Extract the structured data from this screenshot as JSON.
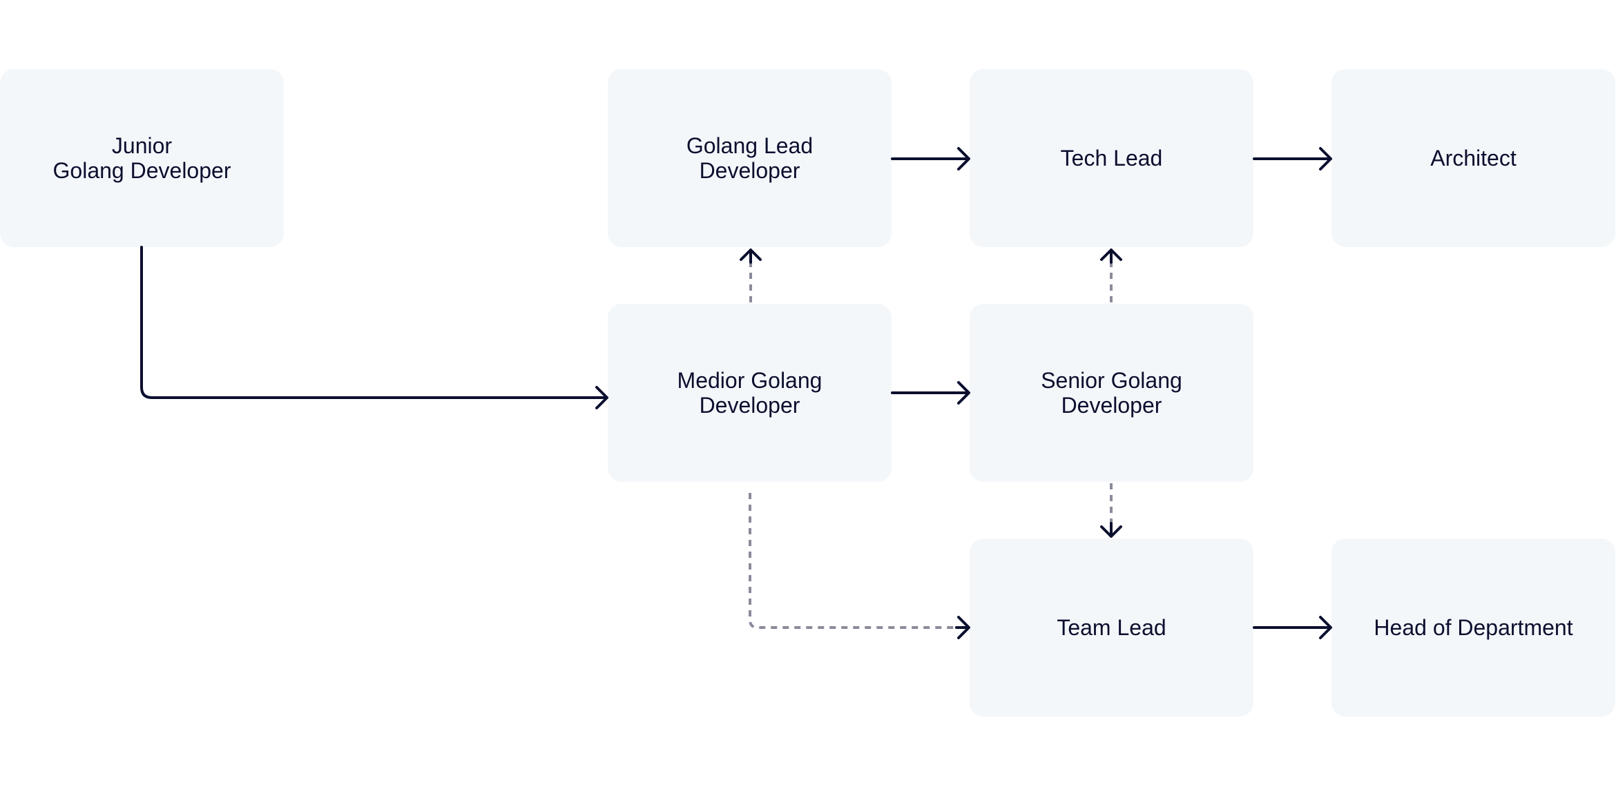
{
  "nodes": {
    "junior": "Junior\nGolang Developer",
    "golang_lead": "Golang Lead\nDeveloper",
    "tech_lead": "Tech Lead",
    "architect": "Architect",
    "medior": "Medior Golang\nDeveloper",
    "senior": "Senior Golang\nDeveloper",
    "team_lead": "Team Lead",
    "head_of_department": "Head of Department"
  },
  "edges": [
    {
      "from": "junior",
      "to": "medior",
      "style": "solid"
    },
    {
      "from": "medior",
      "to": "senior",
      "style": "solid"
    },
    {
      "from": "golang_lead",
      "to": "tech_lead",
      "style": "solid"
    },
    {
      "from": "tech_lead",
      "to": "architect",
      "style": "solid"
    },
    {
      "from": "team_lead",
      "to": "head_of_department",
      "style": "solid"
    },
    {
      "from": "medior",
      "to": "golang_lead",
      "style": "dashed"
    },
    {
      "from": "senior",
      "to": "tech_lead",
      "style": "dashed"
    },
    {
      "from": "senior",
      "to": "team_lead",
      "style": "dashed"
    },
    {
      "from": "medior",
      "to": "team_lead",
      "style": "dashed"
    }
  ],
  "colors": {
    "node_fill": "#f4f7fa",
    "text": "#0b0f2e",
    "solid_edge": "#0b0f2e",
    "dashed_edge": "#8a8b9a"
  }
}
